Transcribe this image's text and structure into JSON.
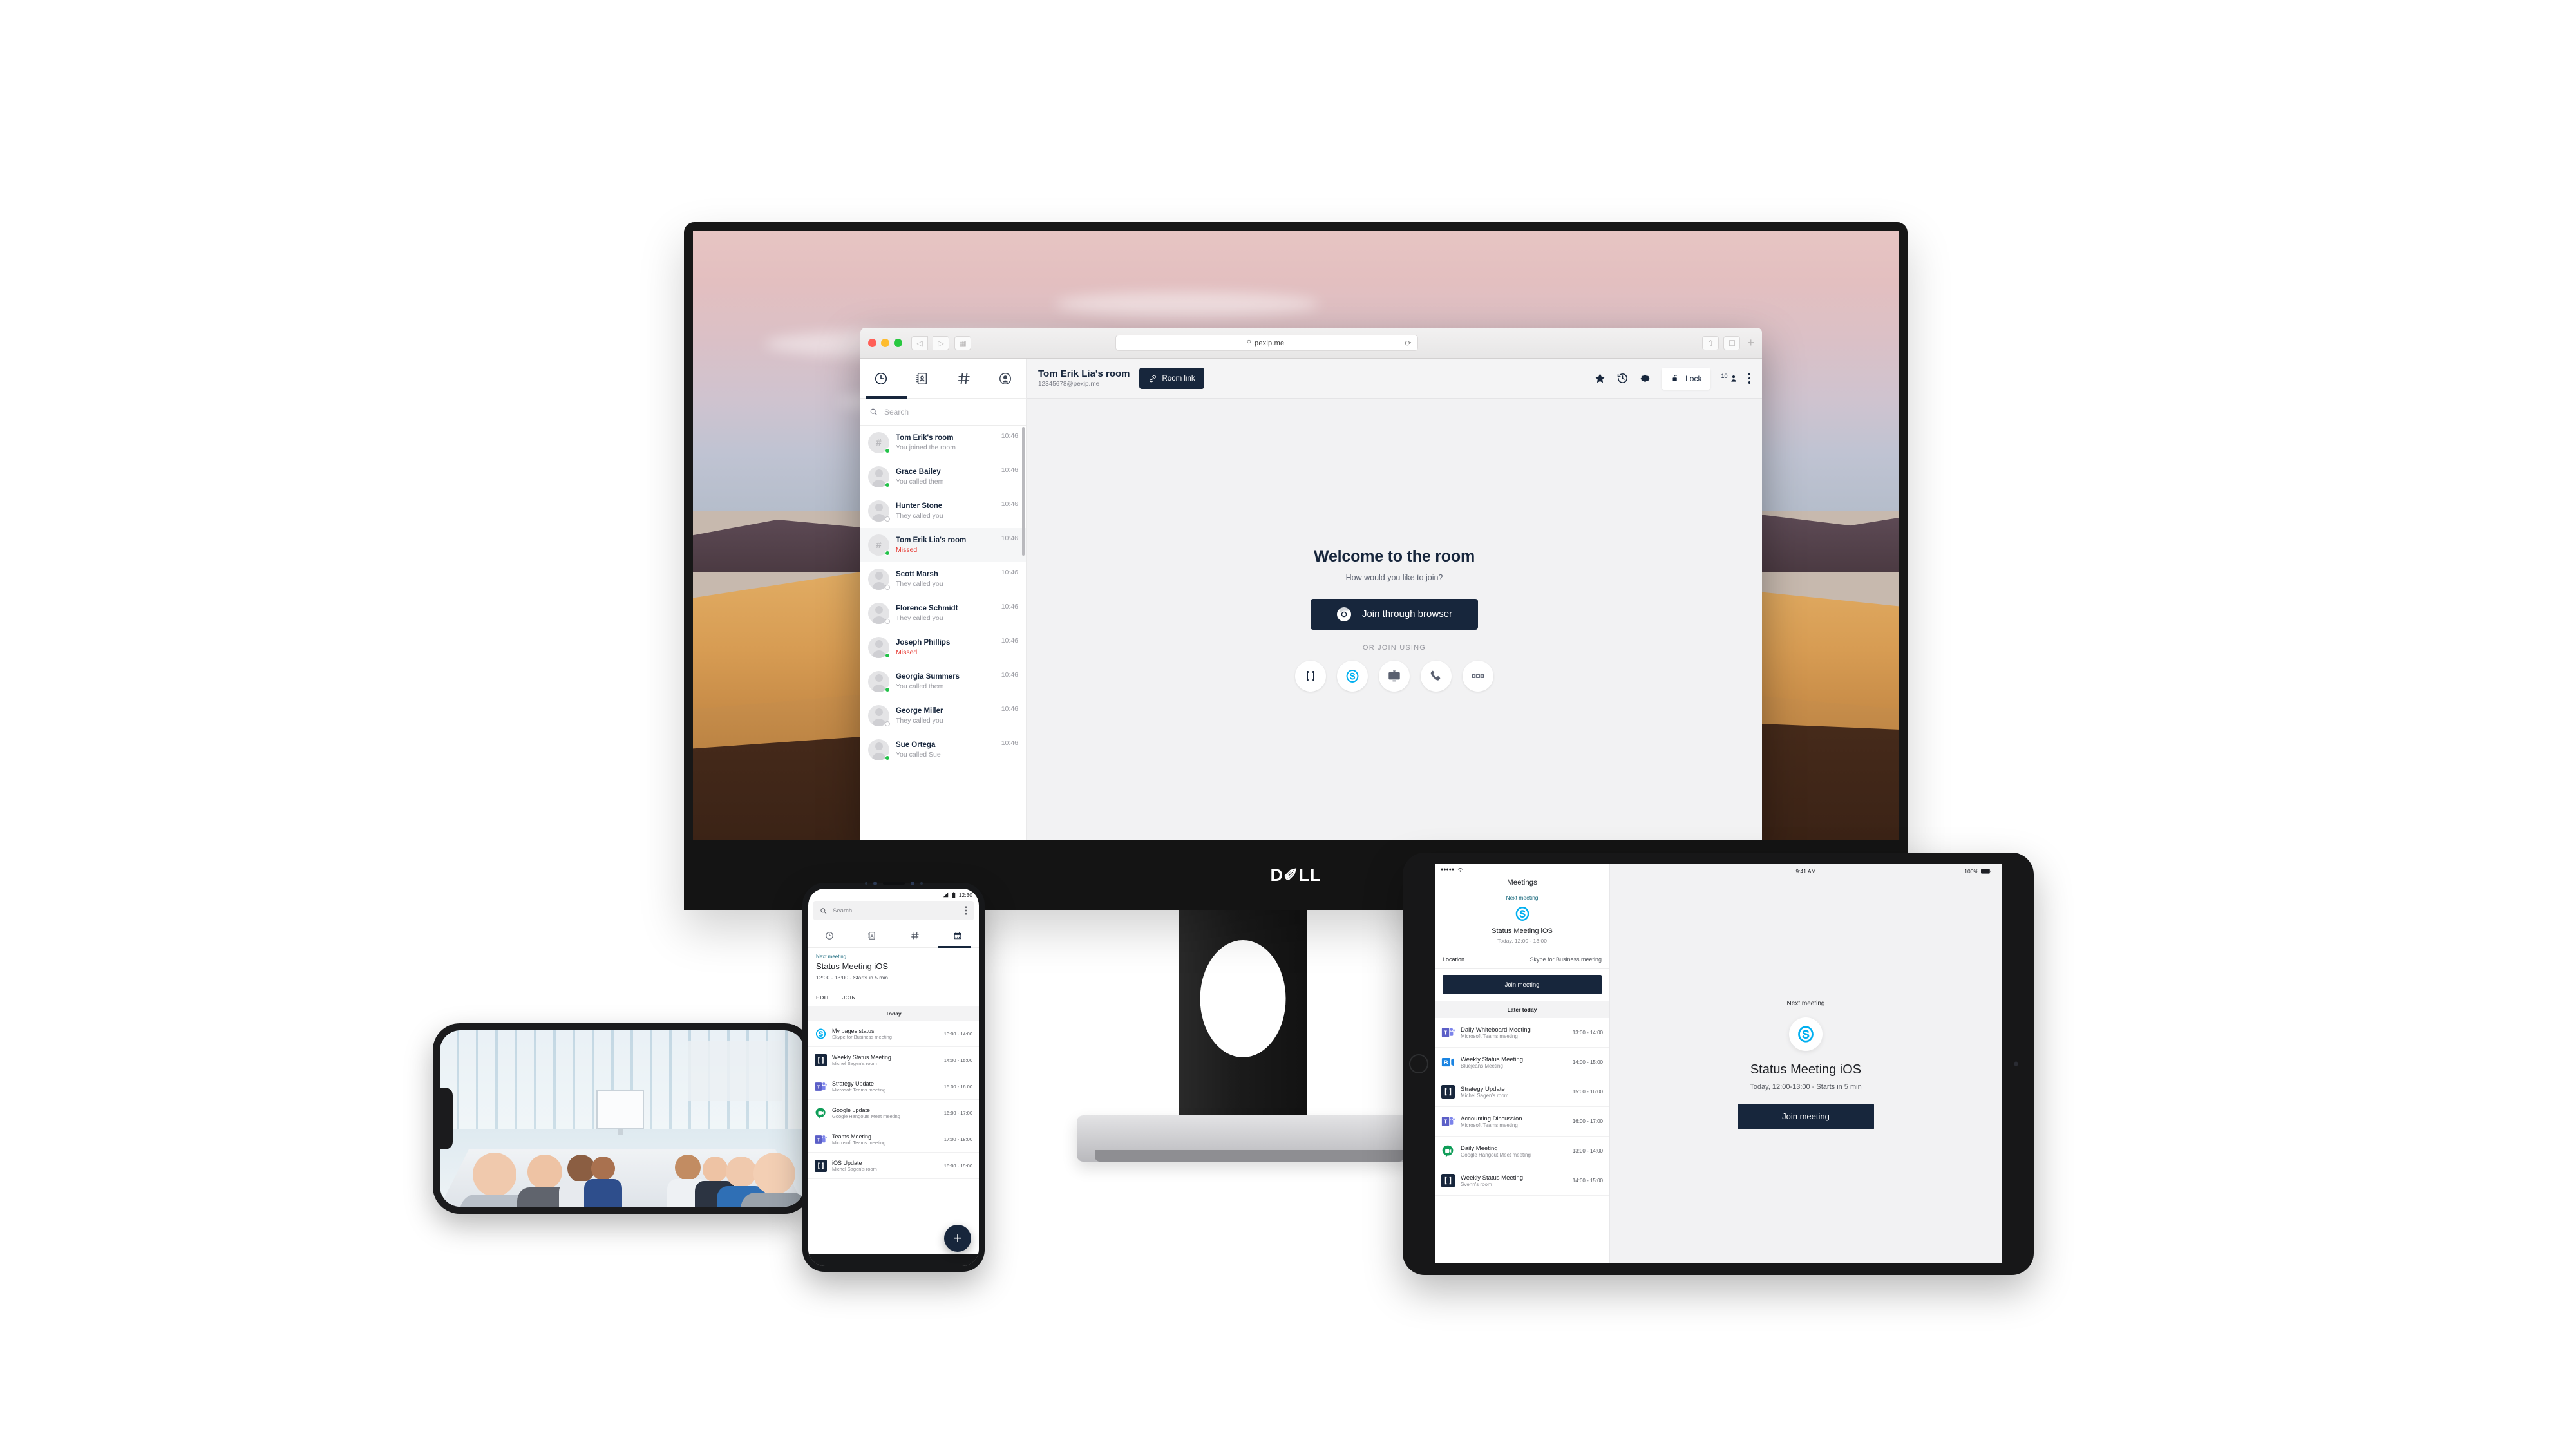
{
  "browser": {
    "url": "pexip.me",
    "search_icon": "search-icon",
    "reload_icon": "reload-icon",
    "share_icon": "share-icon",
    "tabs_icon": "tabs-icon",
    "new_tab": "+"
  },
  "desktop_app": {
    "tabs": [
      {
        "name": "recents",
        "icon": "clock-icon",
        "active": true
      },
      {
        "name": "contacts",
        "icon": "address-book-icon",
        "active": false
      },
      {
        "name": "rooms",
        "icon": "hash-icon",
        "active": false
      },
      {
        "name": "profile",
        "icon": "person-circle-icon",
        "active": false
      }
    ],
    "search_placeholder": "Search",
    "calls": [
      {
        "name": "Tom Erik's room",
        "status": "You joined the room",
        "time": "10:46",
        "type": "room",
        "presence": "online",
        "missed": false,
        "active": false
      },
      {
        "name": "Grace Bailey",
        "status": "You called them",
        "time": "10:46",
        "type": "person",
        "presence": "online",
        "missed": false,
        "active": false
      },
      {
        "name": "Hunter Stone",
        "status": "They called you",
        "time": "10:46",
        "type": "person",
        "presence": "offline",
        "missed": false,
        "active": false
      },
      {
        "name": "Tom Erik Lia's room",
        "status": "Missed",
        "time": "10:46",
        "type": "room",
        "presence": "online",
        "missed": true,
        "active": true
      },
      {
        "name": "Scott Marsh",
        "status": "They called you",
        "time": "10:46",
        "type": "person",
        "presence": "offline",
        "missed": false,
        "active": false
      },
      {
        "name": "Florence Schmidt",
        "status": "They called you",
        "time": "10:46",
        "type": "person",
        "presence": "offline",
        "missed": false,
        "active": false
      },
      {
        "name": "Joseph Phillips",
        "status": "Missed",
        "time": "10:46",
        "type": "person",
        "presence": "online",
        "missed": true,
        "active": false
      },
      {
        "name": "Georgia Summers",
        "status": "You called them",
        "time": "10:46",
        "type": "person",
        "presence": "online",
        "missed": false,
        "active": false
      },
      {
        "name": "George Miller",
        "status": "They called you",
        "time": "10:46",
        "type": "person",
        "presence": "offline",
        "missed": false,
        "active": false
      },
      {
        "name": "Sue Ortega",
        "status": "You called Sue",
        "time": "10:46",
        "type": "person",
        "presence": "online",
        "missed": false,
        "active": false
      }
    ],
    "header": {
      "room_title": "Tom Erik Lia's room",
      "room_alias": "12345678@pexip.me",
      "room_link_label": "Room link",
      "lock_label": "Lock",
      "participant_count": "10",
      "icons": [
        "star-icon",
        "history-icon",
        "gear-icon",
        "lock-icon",
        "participants-icon",
        "kebab-menu-icon"
      ]
    },
    "welcome": {
      "title": "Welcome to the room",
      "subtitle": "How would you like to join?",
      "join_browser_label": "Join through browser",
      "or_join_label": "OR JOIN USING",
      "join_options": [
        {
          "name": "pexip-app-icon",
          "label": "Pexip app"
        },
        {
          "name": "skype-for-business-icon",
          "label": "Skype for Business"
        },
        {
          "name": "desktop-client-icon",
          "label": "Desktop client"
        },
        {
          "name": "phone-icon",
          "label": "Phone"
        },
        {
          "name": "more-options-icon",
          "label": "More"
        }
      ]
    }
  },
  "android_phone": {
    "status_time": "12:30",
    "search_placeholder": "Search",
    "tabs": [
      {
        "name": "recents",
        "icon": "clock-icon",
        "active": false
      },
      {
        "name": "contacts",
        "icon": "address-book-icon",
        "active": false
      },
      {
        "name": "rooms",
        "icon": "hash-icon",
        "active": false
      },
      {
        "name": "calendar",
        "icon": "calendar-icon",
        "active": true
      }
    ],
    "next_meeting_label": "Next meeting",
    "next_meeting_title": "Status Meeting iOS",
    "next_meeting_time": "12:00 - 13:00 - Starts in 5 min",
    "edit_label": "EDIT",
    "join_label": "JOIN",
    "section_label": "Today",
    "fab_label": "+",
    "meetings": [
      {
        "title": "My pages status",
        "sub": "Skype for Business meeting",
        "time": "13:00 - 14:00",
        "icon": "skype"
      },
      {
        "title": "Weekly Status Meeting",
        "sub": "Michel Sagen's room",
        "time": "14:00 - 15:00",
        "icon": "pexip"
      },
      {
        "title": "Strategy Update",
        "sub": "Microsoft Teams meeting",
        "time": "15:00 - 16:00",
        "icon": "teams"
      },
      {
        "title": "Google update",
        "sub": "Google Hangouts Meet meeting",
        "time": "16:00 - 17:00",
        "icon": "hangouts"
      },
      {
        "title": "Teams Meeting",
        "sub": "Microsoft Teams meeting",
        "time": "17:00 - 18:00",
        "icon": "teams"
      },
      {
        "title": "iOS Update",
        "sub": "Michel Sagen's room",
        "time": "18:00 - 19:00",
        "icon": "pexip"
      }
    ]
  },
  "ipad": {
    "left": {
      "signal": "●●●●●",
      "title": "Meetings",
      "next_label": "Next meeting",
      "meeting_title": "Status Meeting iOS",
      "meeting_time": "Today, 12:00 - 13:00",
      "location_key": "Location",
      "location_value": "Skype for Business meeting",
      "join_label": "Join meeting",
      "section_label": "Later today",
      "meetings": [
        {
          "title": "Daily Whiteboard Meeting",
          "sub": "Microsoft Teams meeting",
          "time": "13:00 - 14:00",
          "icon": "teams"
        },
        {
          "title": "Weekly Status Meeting",
          "sub": "Bluejeans Meeting",
          "time": "14:00 - 15:00",
          "icon": "bluejeans"
        },
        {
          "title": "Strategy Update",
          "sub": "Michel Sagen's room",
          "time": "15:00 - 16:00",
          "icon": "pexip"
        },
        {
          "title": "Accounting Discussion",
          "sub": "Microsoft Teams meeting",
          "time": "16:00 - 17:00",
          "icon": "teams"
        },
        {
          "title": "Daily Meeting",
          "sub": "Google Hangout Meet meeting",
          "time": "13:00 - 14:00",
          "icon": "hangouts"
        },
        {
          "title": "Weekly Status Meeting",
          "sub": "Svenn's room",
          "time": "14:00 - 15:00",
          "icon": "pexip"
        }
      ]
    },
    "right": {
      "status_time": "9:41 AM",
      "battery": "100%",
      "next_label": "Next meeting",
      "meeting_title": "Status Meeting iOS",
      "meeting_time": "Today, 12:00-13:00 - Starts in 5 min",
      "join_label": "Join meeting",
      "icon": "skype-for-business-icon"
    }
  },
  "monitor": {
    "brand": "D✐LL"
  },
  "colors": {
    "brand_dark": "#17263c",
    "missed_red": "#e5362f",
    "presence_green": "#24c24a",
    "skype_blue": "#00aff0",
    "teal_label": "#1b6a7e"
  }
}
